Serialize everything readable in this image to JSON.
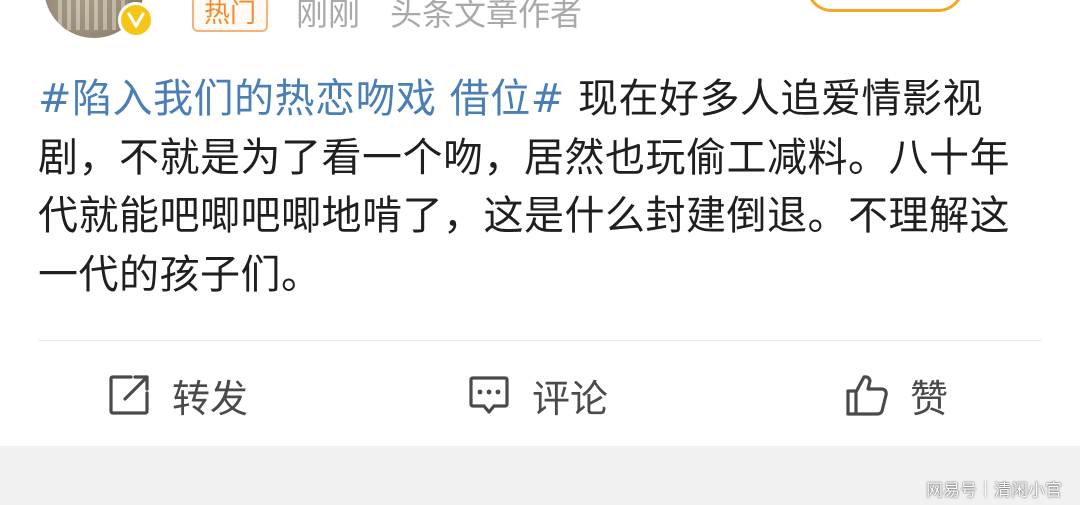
{
  "header": {
    "hot_tag": "热门",
    "time": "刚刚",
    "source": "头条文章作者"
  },
  "post": {
    "topic": "#陷入我们的热恋吻戏 借位#",
    "text": " 现在好多人追爱情影视剧，不就是为了看一个吻，居然也玩偷工减料。八十年代就能吧唧吧唧地啃了，这是什么封建倒退。不理解这一代的孩子们。"
  },
  "actions": {
    "repost_label": "转发",
    "comment_label": "评论",
    "like_label": "赞"
  },
  "icons": {
    "verified": "verified-badge-icon",
    "repost": "share-edit-icon",
    "comment": "comment-bubble-icon",
    "like": "thumbs-up-icon"
  },
  "colors": {
    "topic_link": "#4a7fb5",
    "hot_tag": "#f08a2a",
    "verified_badge": "#f5c518",
    "follow_border": "#f5a623"
  },
  "watermark": {
    "brand": "网易号",
    "author": "清闲小官"
  }
}
